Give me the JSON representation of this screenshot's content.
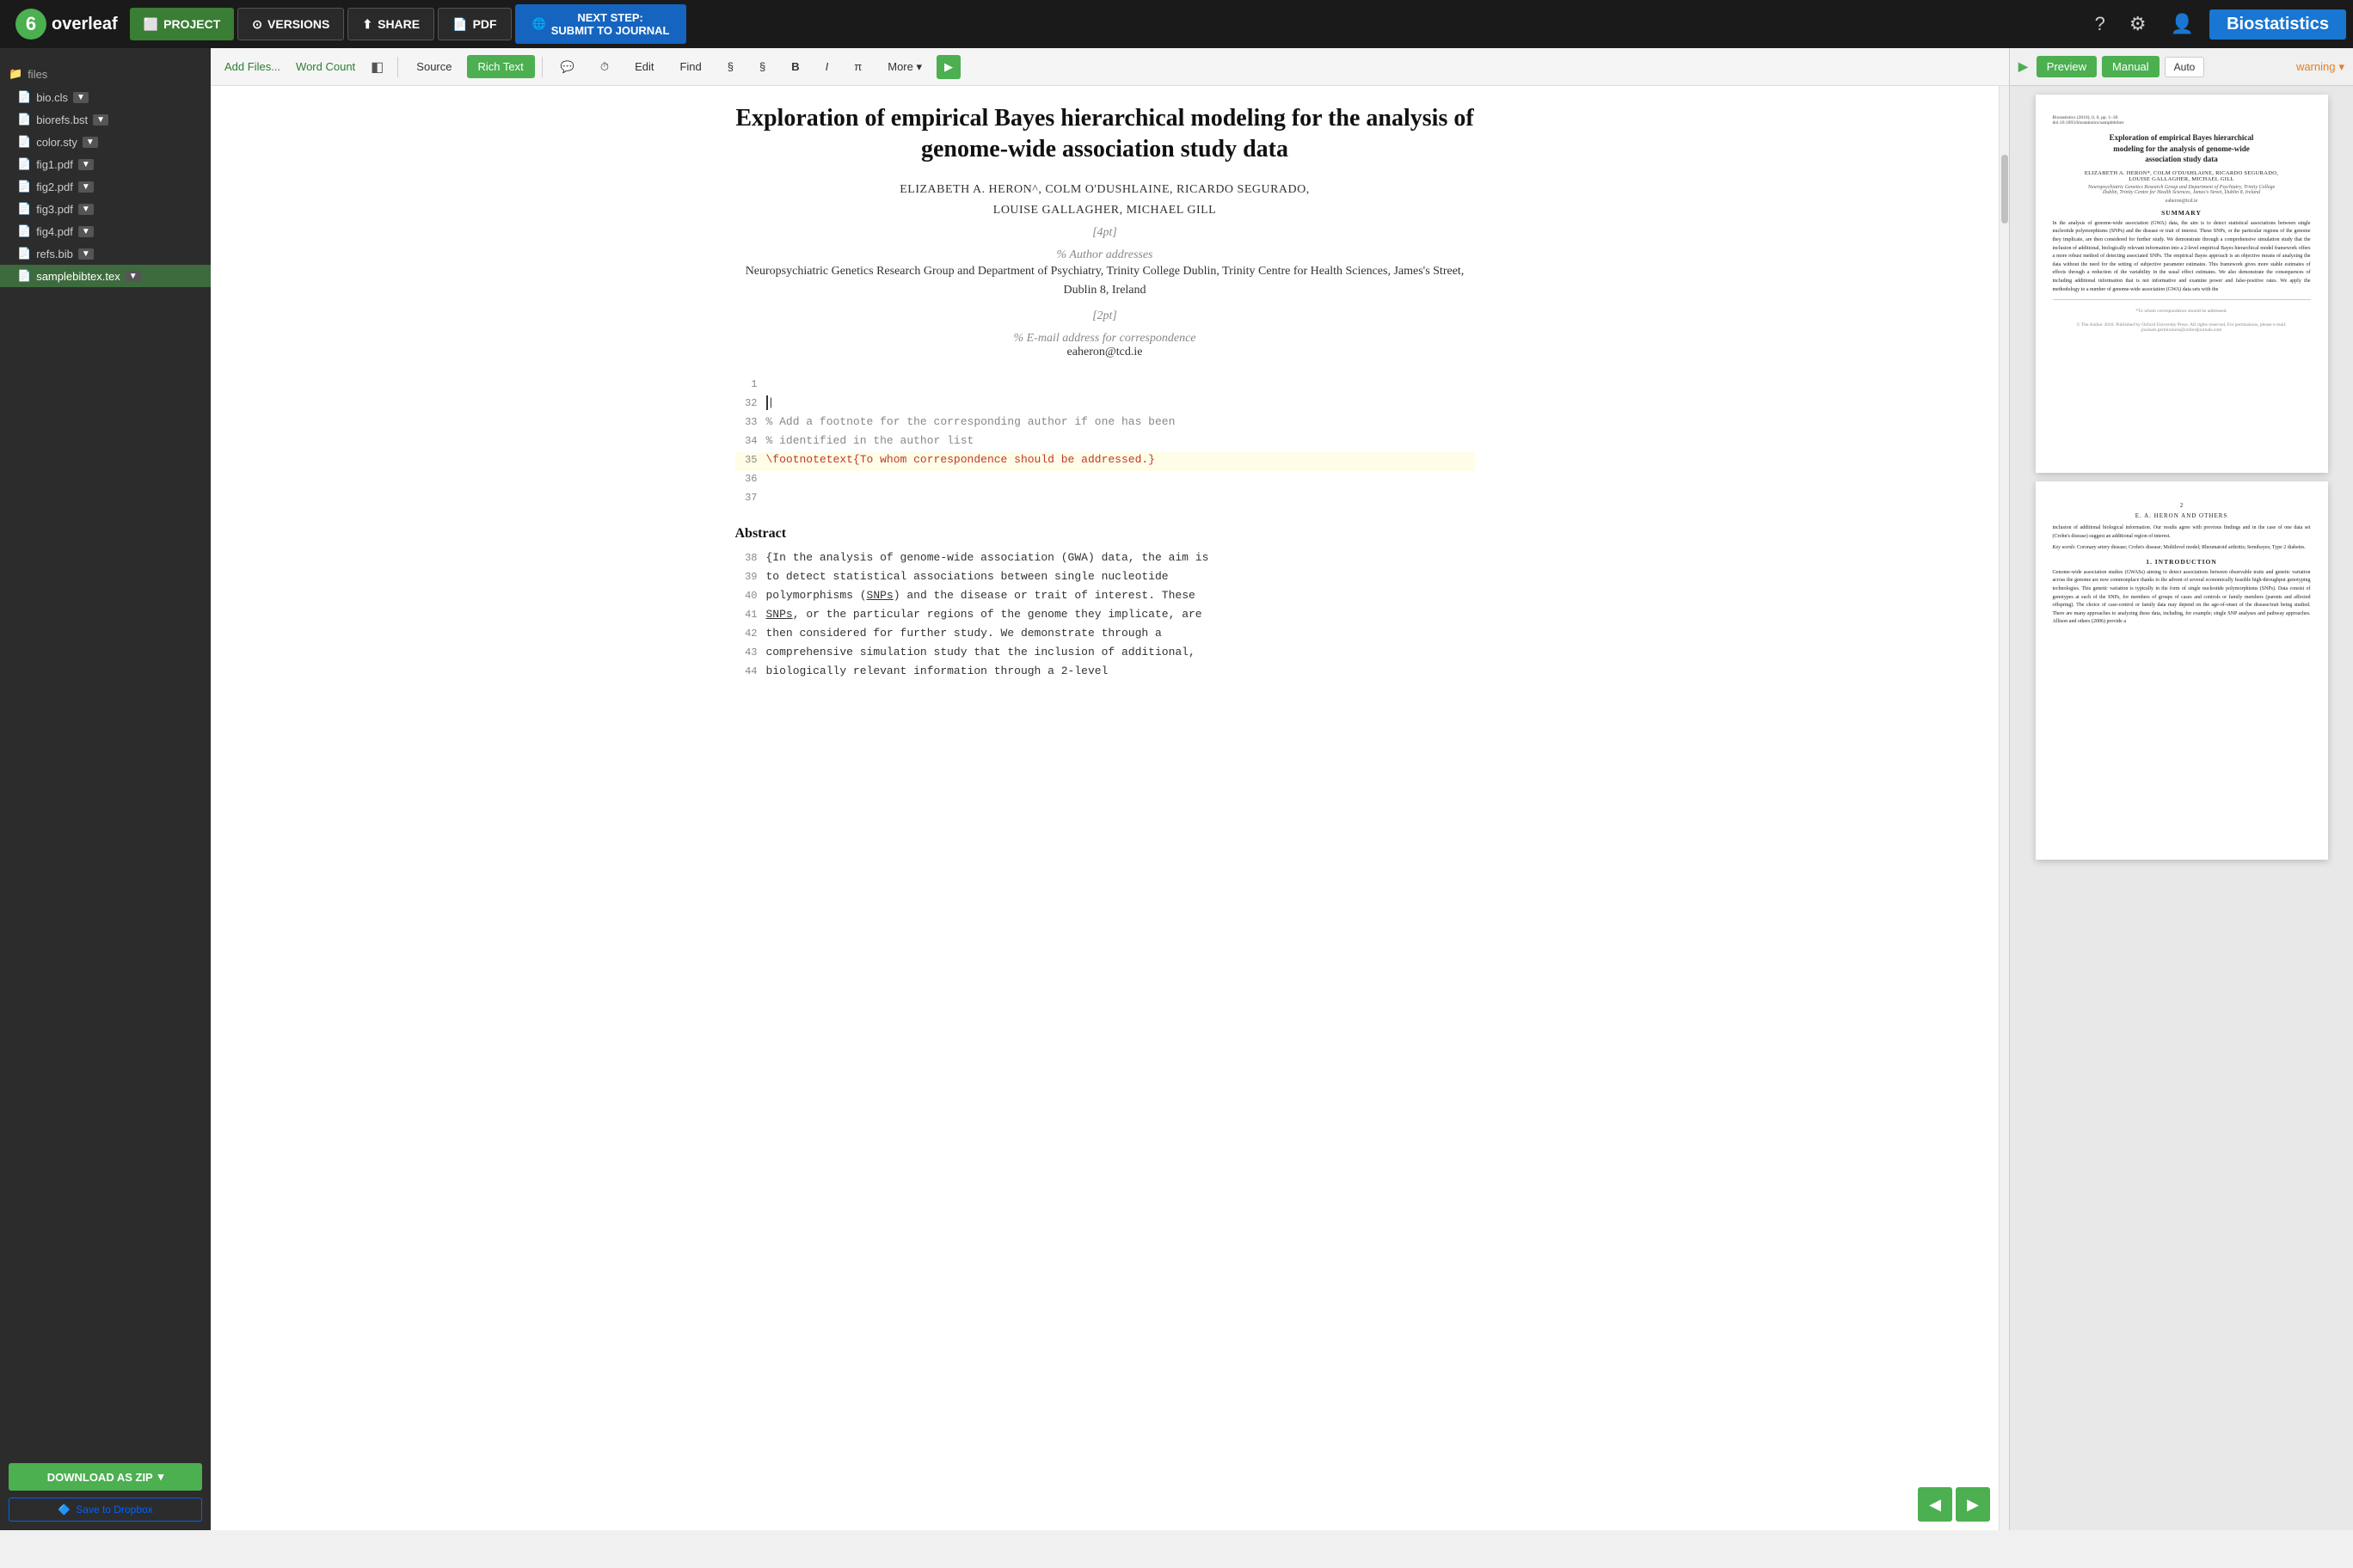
{
  "logo": {
    "circle_text": "6",
    "brand_text": "overleaf"
  },
  "top_nav": {
    "project_btn": "PROJECT",
    "versions_btn": "VERSIONS",
    "share_btn": "SHARE",
    "pdf_btn": "PDF",
    "next_step_line1": "NEXT STEP:",
    "next_step_line2": "SUBMIT TO JOURNAL",
    "help_icon": "?",
    "settings_icon": "⚙",
    "user_icon": "👤",
    "journal_label": "Biostatistics"
  },
  "editor_toolbar": {
    "add_files": "Add Files...",
    "word_count": "Word Count",
    "layout_icon": "◧",
    "source_btn": "Source",
    "rich_text_btn": "Rich Text",
    "comment_icon": "💬",
    "history_icon": "⏱",
    "edit_btn": "Edit",
    "find_btn": "Find",
    "section_icon": "§",
    "section2_icon": "§",
    "bold_btn": "B",
    "italic_btn": "I",
    "math_btn": "π",
    "more_btn": "More",
    "arrow_right": "▶"
  },
  "preview_toolbar": {
    "preview_label": "Preview",
    "manual_btn": "Manual",
    "auto_btn": "Auto",
    "warning_label": "warning",
    "dropdown_icon": "▾"
  },
  "sidebar": {
    "files_label": "files",
    "items": [
      {
        "name": "bio.cls",
        "icon": "📄",
        "has_dropdown": true,
        "active": false
      },
      {
        "name": "biorefs.bst",
        "icon": "📄",
        "has_dropdown": true,
        "active": false
      },
      {
        "name": "color.sty",
        "icon": "📄",
        "has_dropdown": true,
        "active": false
      },
      {
        "name": "fig1.pdf",
        "icon": "📄",
        "has_dropdown": true,
        "active": false
      },
      {
        "name": "fig2.pdf",
        "icon": "📄",
        "has_dropdown": true,
        "active": false
      },
      {
        "name": "fig3.pdf",
        "icon": "📄",
        "has_dropdown": true,
        "active": false
      },
      {
        "name": "fig4.pdf",
        "icon": "📄",
        "has_dropdown": true,
        "active": false
      },
      {
        "name": "refs.bib",
        "icon": "📄",
        "has_dropdown": true,
        "active": false
      },
      {
        "name": "samplebibtex.tex",
        "icon": "📄",
        "has_dropdown": true,
        "active": true
      }
    ],
    "download_btn": "DOWNLOAD AS ZIP",
    "download_dropdown": "▾",
    "dropbox_btn": "Save to Dropbox"
  },
  "document": {
    "title": "Exploration of empirical Bayes hierarchical modeling for the analysis of genome-wide association study data",
    "authors_line1": "ELIZABETH A. HERON^, COLM O'DUSHLAINE, RICARDO SEGURADO,",
    "authors_line2": "LOUISE GALLAGHER, MICHAEL GILL",
    "spacer1": "[4pt]",
    "comment1": "% Author addresses",
    "affiliation": "Neuropsychiatric Genetics Research Group and Department of Psychiatry, Trinity College Dublin, Trinity Centre for Health Sciences, James's Street, Dublin 8, Ireland",
    "spacer2": "[2pt]",
    "comment2": "% E-mail address for correspondence",
    "email": "eaheron@tcd.ie"
  },
  "source_lines": [
    {
      "num": "1",
      "content": "",
      "type": "blank"
    },
    {
      "num": "32",
      "content": "",
      "type": "cursor"
    },
    {
      "num": "33",
      "content": "% Add a footnote for the corresponding author if one has been",
      "type": "comment"
    },
    {
      "num": "34",
      "content": "% identified in the author list",
      "type": "comment"
    },
    {
      "num": "35",
      "content": "\\footnotetext{To whom correspondence should be addressed.}",
      "type": "latex",
      "highlighted": true
    },
    {
      "num": "36",
      "content": "",
      "type": "blank"
    },
    {
      "num": "37",
      "content": "",
      "type": "blank"
    }
  ],
  "abstract": {
    "title": "Abstract",
    "lines": [
      {
        "num": "38",
        "content": "{In the analysis of genome-wide association (GWA) data, the aim is"
      },
      {
        "num": "39",
        "content": "to detect statistical associations between single nucleotide"
      },
      {
        "num": "40",
        "content": "polymorphisms (SNPs) and the disease or trait of interest. These"
      },
      {
        "num": "41",
        "content": "SNPs, or the particular regions of the genome they implicate, are"
      },
      {
        "num": "42",
        "content": "then considered for further study. We demonstrate through a"
      },
      {
        "num": "43",
        "content": "comprehensive simulation study that the inclusion of additional,"
      },
      {
        "num": "44",
        "content": "biologically relevant information through a 2-level"
      }
    ]
  },
  "preview": {
    "page1": {
      "journal_ref": "Biostatistics (2010), 0, 0, pp. 1–30\ndoi:10.1093/biostatistics/samplebibex",
      "title": "Exploration of empirical Bayes hierarchical modeling for the analysis of genome-wide association study data",
      "authors": "ELIZABETH A. HERON*, COLM O'DUSHLAINE, RICARDO SEGURADO,\nLOUISE GALLAGHER, MICHAEL GILL",
      "affiliation": "Neuropsychiatric Genetics Research Group and Department of Psychiatry, Trinity College\nDublin, Trinity Centre for Health Sciences, James's Street, Dublin 8, Ireland",
      "email": "eaheron@tcd.ie",
      "summary_title": "SUMMARY",
      "summary_text": "In the analysis of genome-wide association (GWA) data, the aim is to detect statistical associations between single nucleotide polymorphisms (SNPs) and the disease or trait of interest. These SNPs, or the particular regions of the genome they implicate, are then considered for further study. We demonstrate through a comprehensive simulation study that the inclusion of additional, biologically relevant information into a 2-level empirical Bayes hierarchical model framework offers a more robust method of detecting associated SNPs. The empirical Bayes approach is an objective means of analyzing the data without the need for the setting of subjective parameter estimates. This framework gives more stable estimates of effects through a reduction of the variability in the usual effect estimates. We also demonstrate the consequences of including additional information that is not informative and examine power and false-positive rates. We apply the methodology to a number of genome-wide association (GWA) data sets with the",
      "footnote": "*To whom correspondence should be addressed.",
      "copyright": "© The Author 2010. Published by Oxford University Press. All rights reserved. For permissions, please e-mail: journals.permissions@oxfordjournals.com"
    },
    "page2": {
      "page_num": "2",
      "page_author": "E. A. HERON AND OTHERS",
      "body1": "inclusion of additional biological information. Our results agree with previous findings and in the case of one data set (Crohn's disease) suggest an additional region of interest.",
      "keywords": "Key words: Coronary artery disease; Crohn's disease; Multilevel model; Rheumatoid arthritis; Semibayes; Type 2 diabetes.",
      "intro_title": "1. INTRODUCTION",
      "intro_text": "Genome-wide association studies (GWASs) aiming to detect associations between observable traits and genetic variation across the genome are now commonplace thanks to the advent of several economically feasible high-throughput genotyping technologies. This genetic variation is typically in the form of single nucleotide polymorphisms (SNPs). Data consist of genotypes at each of the SNPs, for members of groups of cases and controls or family members (parents and affected offspring). The choice of case-control or family data may depend on the age-of-onset of the disease/trait being studied. There are many approaches to analyzing these data, including, for example; single SNP analyses and pathway approaches. Allison and others (2006) provide a"
    }
  },
  "colors": {
    "green": "#4CAF50",
    "dark_green": "#2e7d32",
    "nav_bg": "#1a1a1a",
    "sidebar_bg": "#2c2c2c",
    "warning_color": "#e67e22",
    "blue": "#1565C0",
    "highlight_yellow": "#fffde7"
  }
}
